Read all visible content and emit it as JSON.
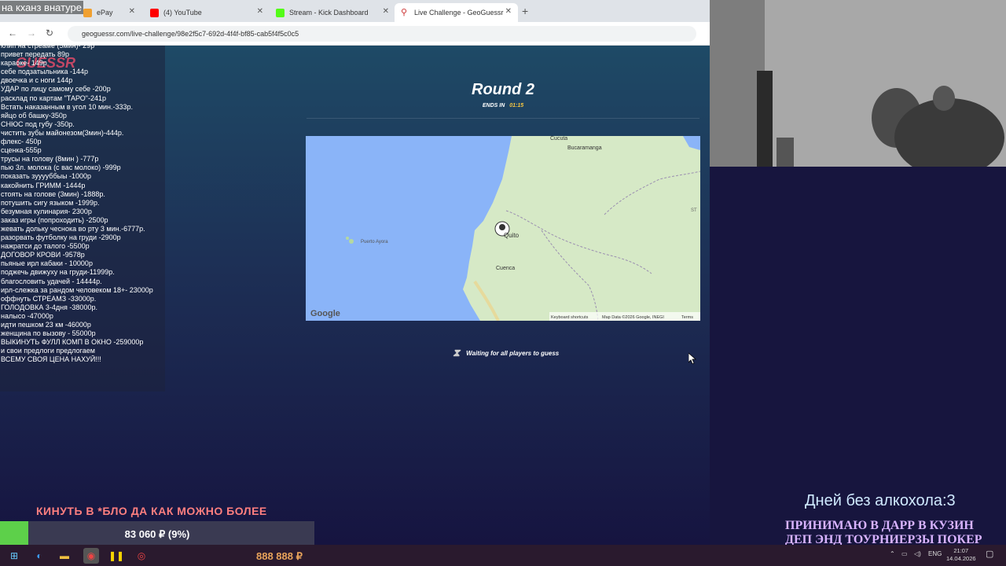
{
  "stream_title": "на кханз внатуре",
  "browser": {
    "tabs": [
      {
        "label": "ePay",
        "icon": "pay-icon",
        "icon_color": "#f0a030"
      },
      {
        "label": "(4) YouTube",
        "icon": "youtube-icon",
        "icon_color": "#ff0000"
      },
      {
        "label": "Stream - Kick Dashboard",
        "icon": "kick-icon",
        "icon_color": "#53fc18"
      },
      {
        "label": "Live Challenge - GeoGuessr",
        "icon": "location-pin-icon",
        "icon_color": "#c33"
      }
    ],
    "new_tab": "+",
    "url": "geoguessr.com/live-challenge/98e2f5c7-692d-4f4f-bf85-cab5f4f5c0c5"
  },
  "game": {
    "logo": "GUESSR",
    "round_title": "Round 2",
    "ends_in_label": "ENDS IN",
    "ends_in_time": "01:15",
    "waiting_text": "Waiting for all players to guess"
  },
  "map": {
    "labels": {
      "cucuta": "Cucuta",
      "bucaramanga": "Bucaramanga",
      "quito": "Quito",
      "cuenca": "Cuenca",
      "puerto_ayora": "Puerto Ayora",
      "st": "ST"
    },
    "google": "Google",
    "shortcuts": "Keyboard shortcuts",
    "mapdata": "Map Data ©2026 Google, INEGI",
    "terms": "Terms",
    "ocean_color": "#8ab4f8",
    "land_color": "#d6e9c6"
  },
  "donations": [
    "клип на стреаме (5мин)- 29р",
    "привет передать 89р",
    "караоке- 149р",
    "себе подзатыльника -144р",
    "двоечка и с ноги 144р",
    "УДАР по лицу самому себе -200р",
    "расклад по картам \"ТАРО\"-241р",
    "Встать наказанным в угол 10 мин.-333р.",
    "яйцо об башку-350р",
    "СНЮС под губу -350р.",
    "чистить зубы майонезом(3мин)-444р.",
    "флекс- 450р",
    "сценка-555р",
    "трусы на голову (8мин ) -777р",
    "пью 3л. молока (с вас молоко) -999р",
    "показать зууууббыы -1000р",
    "какойнить ГРИММ -1444р",
    "стоять на голове (3мин) -1888р.",
    "потушить сигу языком -1999р.",
    "безумная кулинария- 2300р",
    "заказ игры (попроходить) -2500р",
    "жевать дольку чеснока во рту 3 мин.-6777р.",
    "разорвать футболку на груди -2900р",
    "нажратси до талого -5500р",
    "ДОГОВОР КРОВИ -9578р",
    "пьяные ирл кабаки - 10000р",
    "поджечь движуху на груди-11999р.",
    "благословить удачей - 14444р.",
    "ирл-слежка за рандом человеком 18+- 23000р",
    "оффнуть СТРЕАМЗ -33000р.",
    "ГОЛОДОВКА 3-4дня -38000р.",
    "налысо -47000р",
    "идти пешком 23 км -46000р",
    "женщина по вызову - 55000р",
    "ВЫКИНУТЬ ФУЛЛ КОМП В ОКНО -259000р",
    "и свои предлоги предлогаем",
    "ВСЕМУ СВОЯ ЦЕНА НАХУЙ!!!"
  ],
  "ticker": "КИНУТЬ В *БЛО ДА КАК МОЖНО БОЛЕЕ",
  "goal": {
    "text": "83 060 ₽ (9%)",
    "progress": 0.09,
    "color": "#5dd04a"
  },
  "sober": "Дней  без  алкохола:3",
  "promo": [
    "ПРИНИМАЮ В ДАРР В КУЗИН",
    "ДЕП ЭНД ТОУРНИЕРЗЫ ПОКЕР"
  ],
  "taskbar": {
    "counter": "888 888 ₽",
    "lang": "ENG",
    "time": "21:07",
    "date": "14.04.2026"
  }
}
